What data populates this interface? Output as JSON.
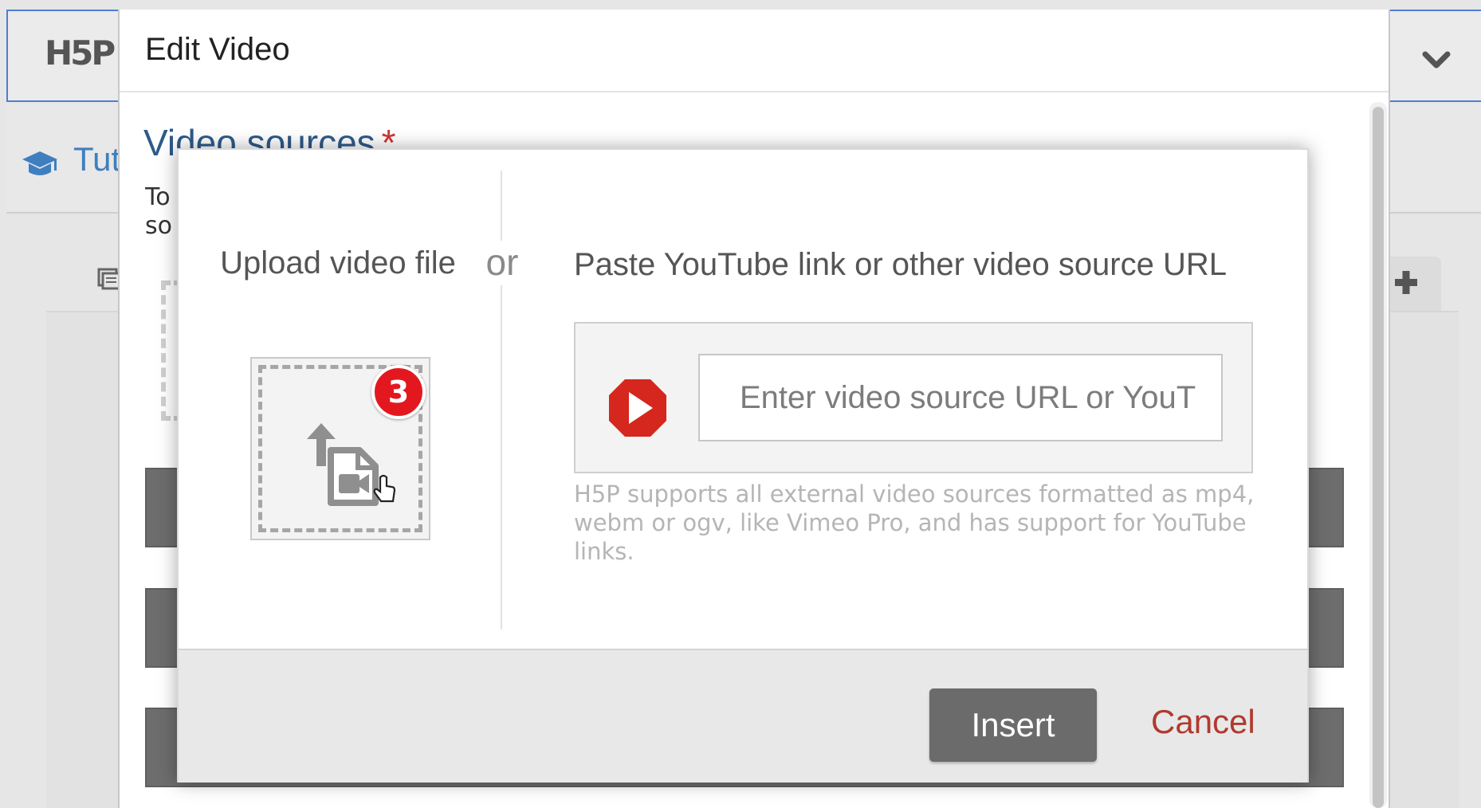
{
  "background": {
    "logo_text": "H5P",
    "nav_label": "Tut",
    "icons": [
      "graduation-cap-icon",
      "chevron-down-icon",
      "list-icon",
      "plus-icon"
    ]
  },
  "edit_dialog": {
    "title": "Edit Video",
    "section_title": "Video sources",
    "required_marker": "*",
    "description_lines": [
      "To",
      "so"
    ]
  },
  "insert_modal": {
    "upload_title": "Upload video file",
    "or_label": "or",
    "url_title": "Paste YouTube link or other video source URL",
    "url_input": {
      "value": "",
      "placeholder": "Enter video source URL or YouT"
    },
    "help_text": "H5P supports all external video sources formatted as mp4, webm or ogv, like Vimeo Pro, and has support for YouTube links.",
    "badge_count": "3",
    "insert_label": "Insert",
    "cancel_label": "Cancel"
  },
  "colors": {
    "accent_blue": "#2e5a8a",
    "badge_red": "#e3181f",
    "youtube_red": "#d5271d",
    "cancel_red": "#b03a2e"
  }
}
